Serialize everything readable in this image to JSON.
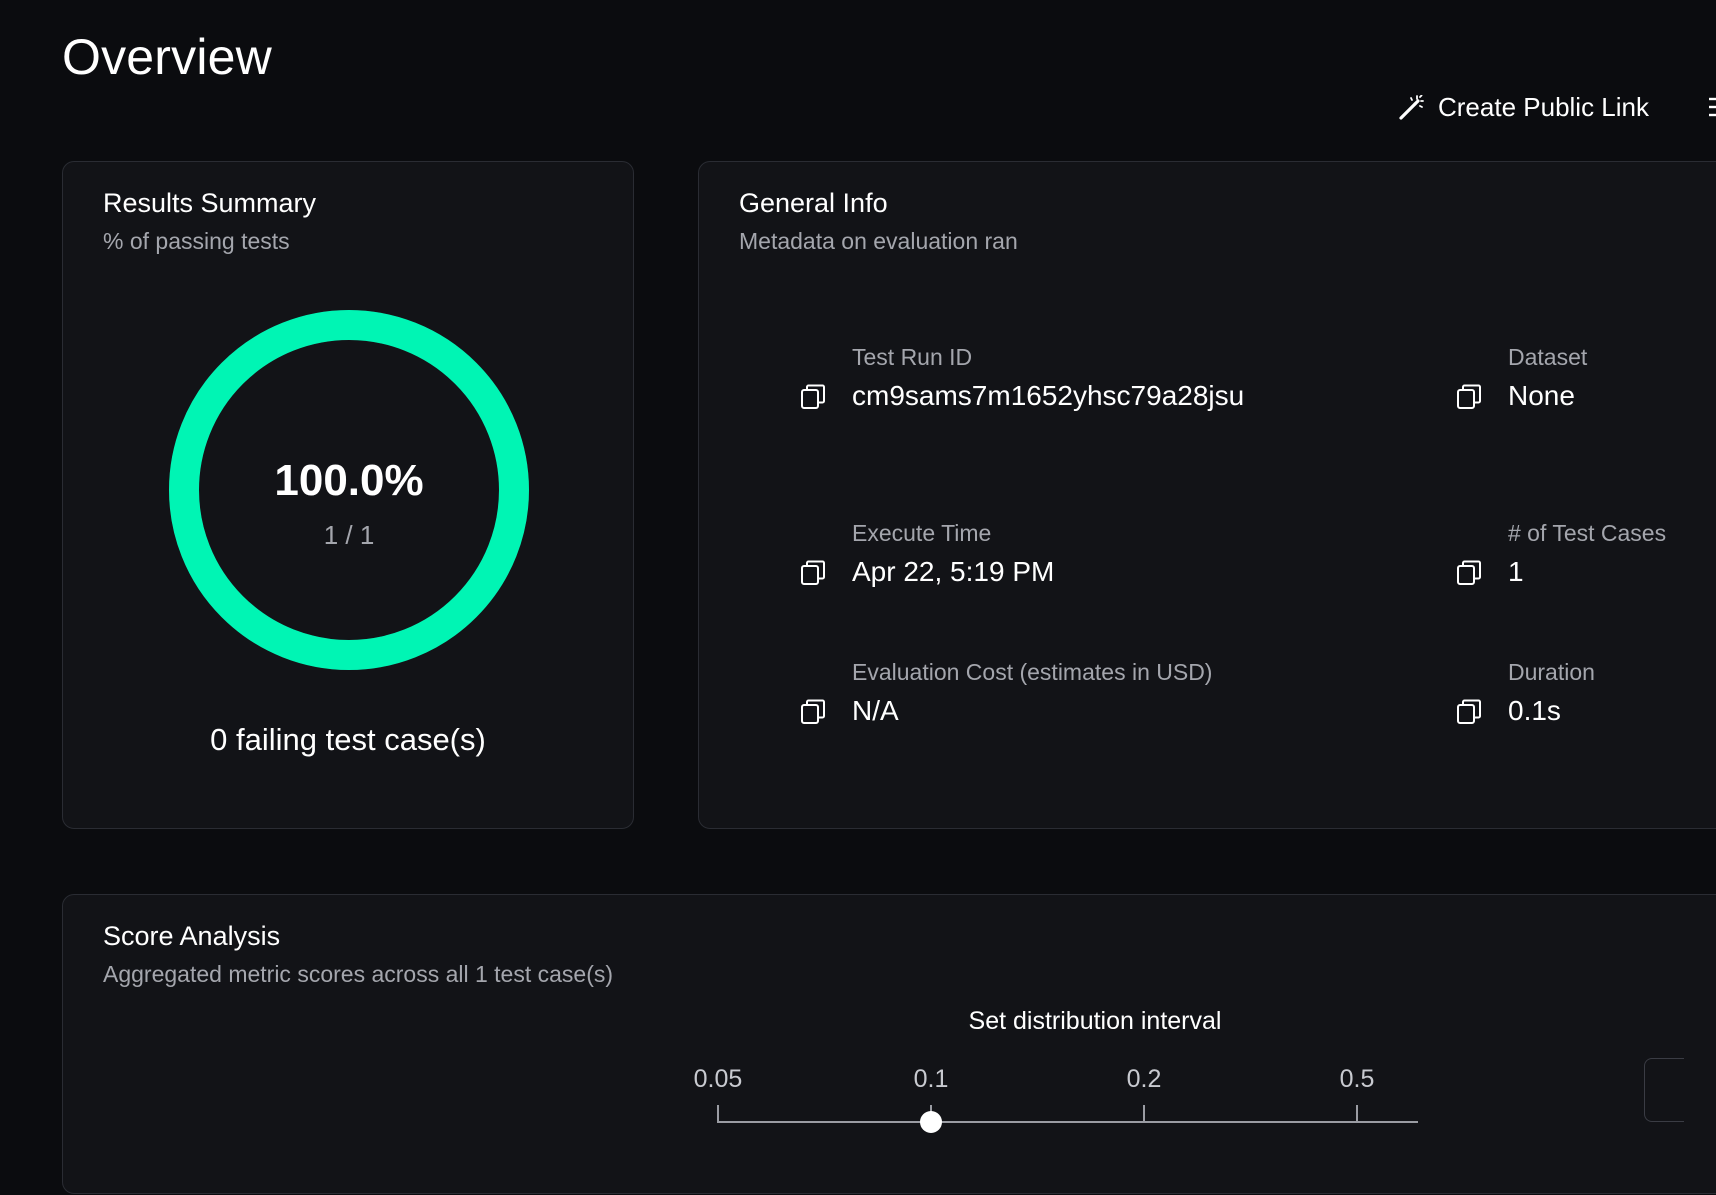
{
  "page": {
    "title": "Overview"
  },
  "header": {
    "public_link_label": "Create Public Link",
    "public_link_icon": "magic-wand-icon",
    "more_icon": "more-icon"
  },
  "results_summary": {
    "title": "Results Summary",
    "subtitle": "% of passing tests",
    "percent_text": "100.0%",
    "pass_fraction": 1.0,
    "fraction_text": "1 / 1",
    "failing_text": "0 failing test case(s)",
    "ring_color": "#00f5b4"
  },
  "general_info": {
    "title": "General Info",
    "subtitle": "Metadata on evaluation ran",
    "items": [
      {
        "label": "Test Run ID",
        "value": "cm9sams7m1652yhsc79a28jsu",
        "icon": "copy-icon"
      },
      {
        "label": "Dataset",
        "value": "None",
        "icon": "copy-icon"
      },
      {
        "label": "Execute Time",
        "value": "Apr 22, 5:19 PM",
        "icon": "copy-icon"
      },
      {
        "label": "# of Test Cases",
        "value": "1",
        "icon": "copy-icon"
      },
      {
        "label": "Evaluation Cost (estimates in USD)",
        "value": "N/A",
        "icon": "copy-icon"
      },
      {
        "label": "Duration",
        "value": "0.1s",
        "icon": "copy-icon"
      }
    ]
  },
  "score_analysis": {
    "title": "Score Analysis",
    "subtitle": "Aggregated metric scores across all 1 test case(s)",
    "interval_title": "Set distribution interval",
    "interval_options": [
      "0.05",
      "0.1",
      "0.2",
      "0.5"
    ],
    "selected_interval": "0.1"
  }
}
